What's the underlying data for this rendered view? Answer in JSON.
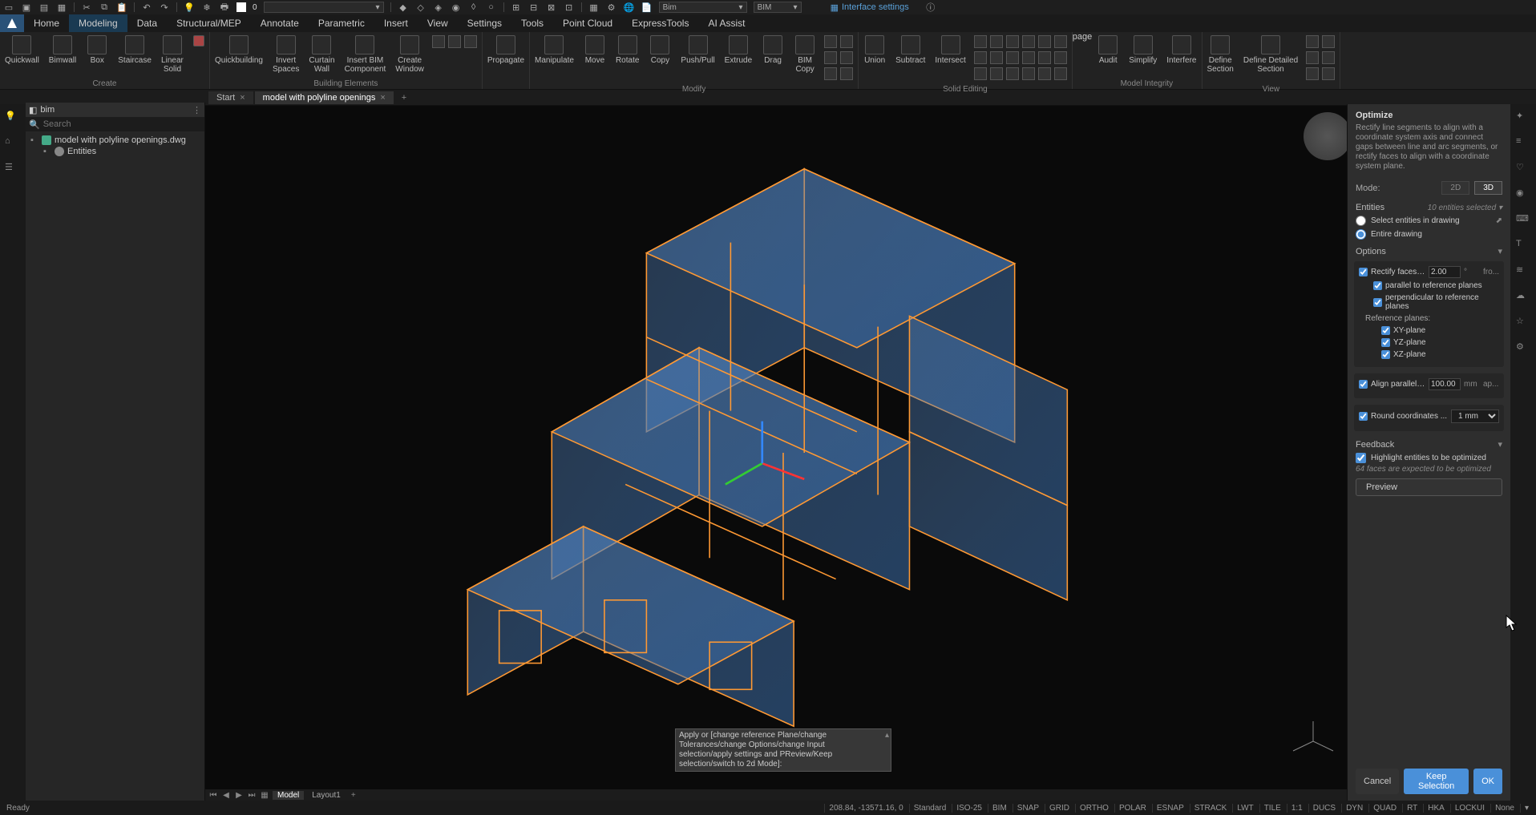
{
  "titlebar": {
    "zero": "0",
    "combo1_value": "",
    "combo_bim": "Bim",
    "combo_bim2": "BIM",
    "interface_settings": "Interface settings"
  },
  "menu": {
    "tabs": [
      "Home",
      "Modeling",
      "Data",
      "Structural/MEP",
      "Annotate",
      "Parametric",
      "Insert",
      "View",
      "Settings",
      "Tools",
      "Point Cloud",
      "ExpressTools",
      "AI Assist"
    ],
    "active_index": 1
  },
  "ribbon": {
    "groups": [
      {
        "label": "Create",
        "buttons": [
          "Quickwall",
          "Bimwall",
          "Box",
          "Staircase",
          "Linear\nSolid"
        ]
      },
      {
        "label": "Building Elements",
        "buttons": [
          "Quickbuilding",
          "Invert\nSpaces",
          "Curtain\nWall",
          "Insert BIM\nComponent",
          "Create\nWindow"
        ]
      },
      {
        "label": "",
        "buttons": [
          "Propagate"
        ]
      },
      {
        "label": "Modify",
        "buttons": [
          "Manipulate",
          "Move",
          "Rotate",
          "Copy",
          "Push/Pull",
          "Extrude",
          "Drag",
          "BIM\nCopy"
        ]
      },
      {
        "label": "Solid Editing",
        "buttons": [
          "Union",
          "Subtract",
          "Intersect"
        ]
      },
      {
        "label": "Model Integrity",
        "buttons": [
          "Audit",
          "Simplify",
          "Interfere"
        ]
      },
      {
        "label": "View",
        "buttons": [
          "Define\nSection",
          "Define Detailed\nSection"
        ]
      }
    ]
  },
  "doc_tabs": {
    "tabs": [
      {
        "label": "Start",
        "closable": true
      },
      {
        "label": "model with polyline openings",
        "closable": true,
        "active": true
      }
    ]
  },
  "tree": {
    "title": "bim",
    "search_placeholder": "Search",
    "root": "model with polyline openings.dwg",
    "child": "Entities"
  },
  "layout": {
    "tabs": [
      "Model",
      "Layout1"
    ],
    "active": 0
  },
  "cmdline": {
    "text": "Apply or [change reference Plane/change\nTolerances/change Options/change Input\nselection/apply settings and PReview/Keep\nselection/switch to 2d Mode]:"
  },
  "optimize": {
    "title": "Optimize",
    "desc": "Rectify line segments to align with a coordinate system axis and connect gaps between line and arc segments, or rectify faces to align with a coordinate system plane.",
    "mode_label": "Mode:",
    "mode_2d": "2D",
    "mode_3d": "3D",
    "entities_label": "Entities",
    "entities_count": "10 entities selected",
    "radio_select": "Select entities in drawing",
    "radio_entire": "Entire drawing",
    "options_label": "Options",
    "rectify_faces": "Rectify faces tha...",
    "rectify_value": "2.00",
    "rectify_unit": "°",
    "rectify_suffix": "fro...",
    "parallel": "parallel to reference planes",
    "perpendicular": "perpendicular to reference planes",
    "ref_planes": "Reference planes:",
    "xy": "XY-plane",
    "yz": "YZ-plane",
    "xz": "XZ-plane",
    "align_parallel": "Align parallel ...",
    "align_value": "100.00",
    "align_unit": "mm",
    "align_suffix": "ap...",
    "round_coord": "Round coordinates ...",
    "round_value": "1 mm",
    "feedback_label": "Feedback",
    "highlight": "Highlight entities to be optimized",
    "feedback_note": "64 faces are expected to be optimized",
    "preview": "Preview",
    "cancel": "Cancel",
    "keep": "Keep Selection",
    "ok": "OK"
  },
  "status": {
    "ready": "Ready",
    "coords": "208.84, -13571.16, 0",
    "pills": [
      "Standard",
      "ISO-25",
      "BIM",
      "SNAP",
      "GRID",
      "ORTHO",
      "POLAR",
      "ESNAP",
      "STRACK",
      "LWT",
      "TILE",
      "1:1",
      "DUCS",
      "DYN",
      "QUAD",
      "RT",
      "HKA",
      "LOCKUI",
      "None"
    ]
  }
}
